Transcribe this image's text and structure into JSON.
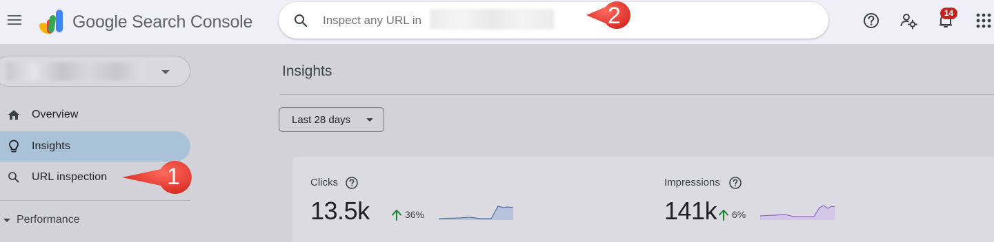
{
  "app": {
    "title": "Google Search Console"
  },
  "search": {
    "placeholder": "Inspect any URL in"
  },
  "header": {
    "notifications_count": "14"
  },
  "annotations": [
    "1",
    "2"
  ],
  "sidebar": {
    "items": [
      {
        "label": "Overview",
        "icon": "home-icon"
      },
      {
        "label": "Insights",
        "icon": "lightbulb-icon",
        "active": true
      },
      {
        "label": "URL inspection",
        "icon": "search-icon"
      }
    ],
    "section": {
      "label": "Performance"
    }
  },
  "main": {
    "title": "Insights",
    "date_range": "Last 28 days",
    "metrics": [
      {
        "label": "Clicks",
        "value": "13.5k",
        "delta": "36%",
        "color": "#4f6fa6"
      },
      {
        "label": "Impressions",
        "value": "141k",
        "delta": "6%",
        "color": "#8e6cc3"
      }
    ]
  },
  "colors": {
    "accent_active": "#a9c2d7",
    "callout_red": "#e53935",
    "badge_red": "#c5221f",
    "delta_green": "#188038"
  }
}
